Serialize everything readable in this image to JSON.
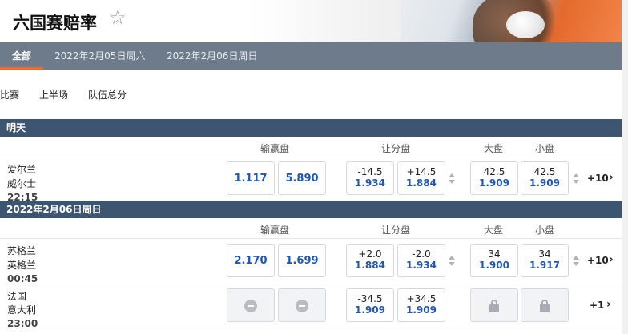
{
  "header": {
    "title": "六国赛赔率",
    "star_icon": "star-outline-icon",
    "tabs": [
      "全部",
      "2022年2月05日周六",
      "2022年2月06日周日"
    ]
  },
  "subtabs": [
    "比赛",
    "上半场",
    "队伍总分"
  ],
  "columns": {
    "moneyline": "输赢盘",
    "handicap": "让分盘",
    "over": "大盘",
    "under": "小盘"
  },
  "sections": [
    {
      "label": "明天",
      "matches": [
        {
          "home": "爱尔兰",
          "away": "威尔士",
          "time": "22:15",
          "ml": [
            "1.117",
            "5.890"
          ],
          "hcap": [
            {
              "line": "-14.5",
              "price": "1.934"
            },
            {
              "line": "+14.5",
              "price": "1.884"
            }
          ],
          "total": [
            {
              "line": "42.5",
              "price": "1.909"
            },
            {
              "line": "42.5",
              "price": "1.909"
            }
          ],
          "more": "+10"
        }
      ]
    },
    {
      "label": "2022年2月06日周日",
      "matches": [
        {
          "home": "苏格兰",
          "away": "英格兰",
          "time": "00:45",
          "ml": [
            "2.170",
            "1.699"
          ],
          "hcap": [
            {
              "line": "+2.0",
              "price": "1.884"
            },
            {
              "line": "-2.0",
              "price": "1.934"
            }
          ],
          "total": [
            {
              "line": "34",
              "price": "1.900"
            },
            {
              "line": "34",
              "price": "1.917"
            }
          ],
          "more": "+10"
        },
        {
          "home": "法国",
          "away": "意大利",
          "time": "23:00",
          "ml_state": "suspended",
          "hcap": [
            {
              "line": "-34.5",
              "price": "1.909"
            },
            {
              "line": "+34.5",
              "price": "1.909"
            }
          ],
          "total_state": "locked",
          "more": "+1"
        }
      ]
    }
  ],
  "colors": {
    "accent": "#ec6b2d",
    "section_bar": "#3e5571",
    "tab_bar": "#6d7b8a",
    "odds_blue": "#1f57b8"
  }
}
